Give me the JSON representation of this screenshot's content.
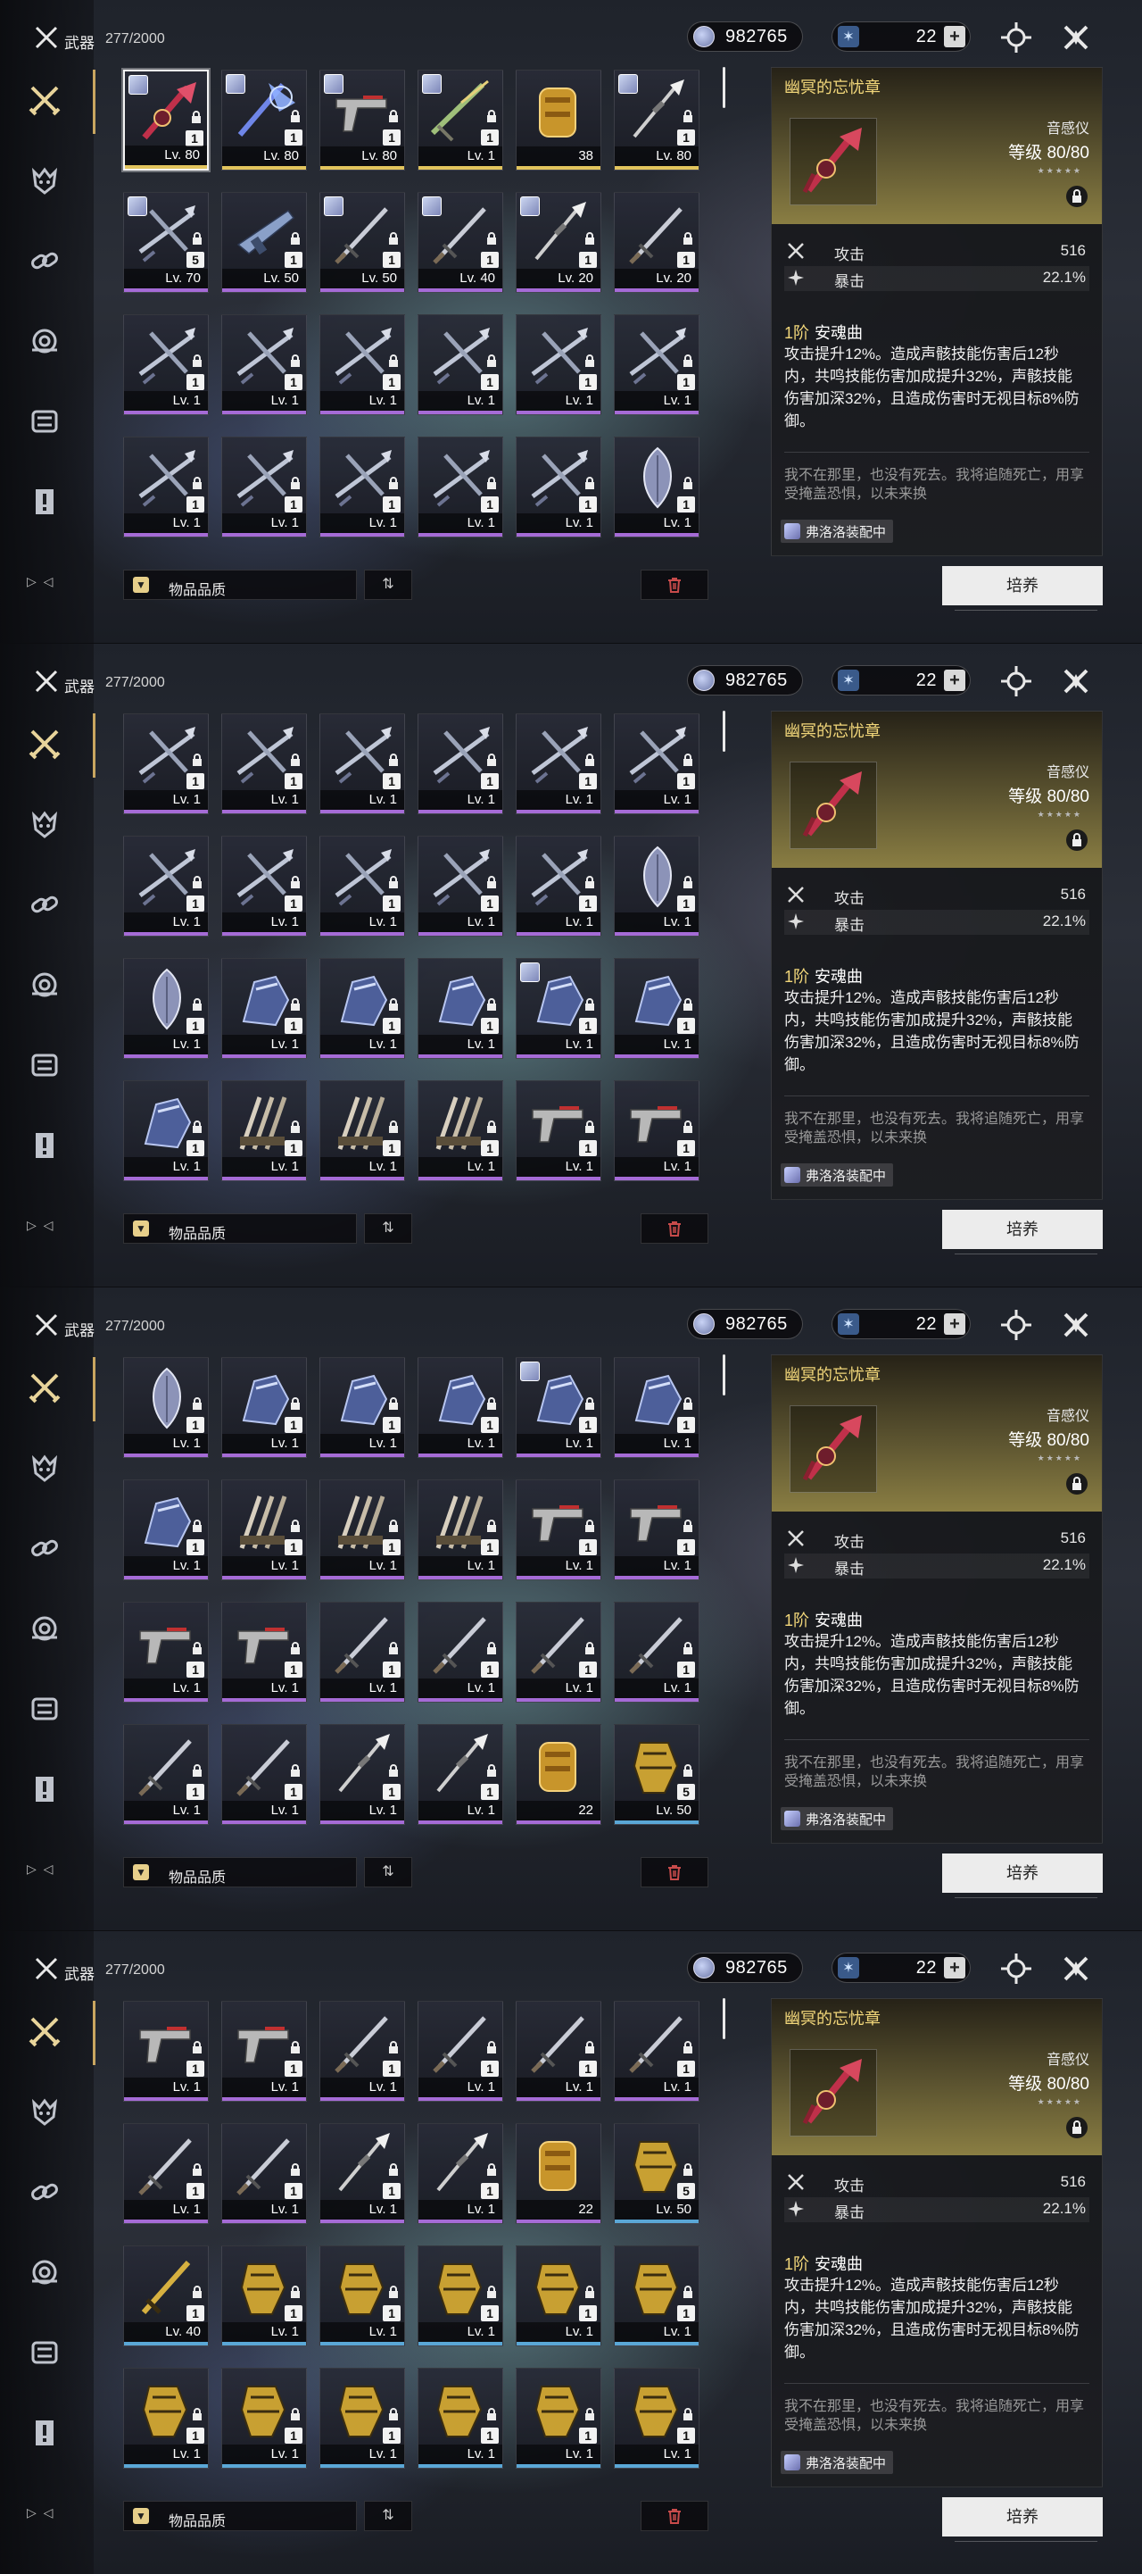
{
  "header": {
    "title": "武器",
    "count": "277/2000"
  },
  "currency": {
    "value": "982765"
  },
  "stamina": {
    "value": "22",
    "plus": "+"
  },
  "sort": {
    "label": "物品品质",
    "order_glyph": "⇅"
  },
  "nav_arrows": "▷ ◁",
  "detail": {
    "name": "幽冥的忘忧章",
    "type": "音感仪",
    "level": "等级 80/80",
    "stars": "★★★★★",
    "stats": [
      {
        "name": "攻击",
        "value": "516"
      },
      {
        "name": "暴击",
        "value": "22.1%"
      }
    ],
    "skill_rank": "1阶",
    "skill_name": "安魂曲",
    "skill_desc": "攻击提升12%。造成声骸技能伤害后12秒内，共鸣技能伤害加成提升32%，声骸技能伤害加深32%，且造成伤害时无视目标8%防御。",
    "flavor": "我不在那里，也没有死去。我将追随死亡，用享受掩盖恐惧，以未来换",
    "equipped_label": "弗洛洛装配中",
    "develop_label": "培养"
  },
  "colors": {
    "accent_gold": "#c9a660",
    "purple": "#a56bd6",
    "blue": "#5aa7d6",
    "gold": "#e2c45d"
  },
  "panels": [
    {
      "cells": [
        {
          "w": "crimson",
          "qty": "1",
          "level": "Lv. 80",
          "q": "gold",
          "sel": true,
          "av": true
        },
        {
          "w": "blueblade",
          "qty": "1",
          "level": "Lv. 80",
          "q": "gold",
          "av": true
        },
        {
          "w": "pistol",
          "qty": "1",
          "level": "Lv. 80",
          "q": "gold",
          "av": true
        },
        {
          "w": "greenblade",
          "qty": "1",
          "level": "Lv. 1",
          "q": "gold",
          "av": true
        },
        {
          "w": "tube",
          "qty": "",
          "level": "38",
          "q": "gold"
        },
        {
          "w": "spear",
          "qty": "1",
          "level": "Lv. 80",
          "q": "gold",
          "av": true
        },
        {
          "w": "cross",
          "qty": "5",
          "level": "Lv. 70",
          "q": "purple",
          "av": true
        },
        {
          "w": "gun",
          "qty": "1",
          "level": "Lv. 50",
          "q": "purple"
        },
        {
          "w": "sword",
          "qty": "1",
          "level": "Lv. 50",
          "q": "purple",
          "av": true
        },
        {
          "w": "sword",
          "qty": "1",
          "level": "Lv. 40",
          "q": "purple",
          "av": true
        },
        {
          "w": "spear",
          "qty": "1",
          "level": "Lv. 20",
          "q": "purple",
          "av": true
        },
        {
          "w": "sword",
          "qty": "1",
          "level": "Lv. 20",
          "q": "purple"
        },
        {
          "w": "cross",
          "qty": "1",
          "level": "Lv. 1",
          "q": "purple"
        },
        {
          "w": "cross",
          "qty": "1",
          "level": "Lv. 1",
          "q": "purple"
        },
        {
          "w": "cross",
          "qty": "1",
          "level": "Lv. 1",
          "q": "purple"
        },
        {
          "w": "cross",
          "qty": "1",
          "level": "Lv. 1",
          "q": "purple"
        },
        {
          "w": "cross",
          "qty": "1",
          "level": "Lv. 1",
          "q": "purple"
        },
        {
          "w": "cross",
          "qty": "1",
          "level": "Lv. 1",
          "q": "purple"
        },
        {
          "w": "cross",
          "qty": "1",
          "level": "Lv. 1",
          "q": "purple"
        },
        {
          "w": "cross",
          "qty": "1",
          "level": "Lv. 1",
          "q": "purple"
        },
        {
          "w": "cross",
          "qty": "1",
          "level": "Lv. 1",
          "q": "purple"
        },
        {
          "w": "cross",
          "qty": "1",
          "level": "Lv. 1",
          "q": "purple"
        },
        {
          "w": "cross",
          "qty": "1",
          "level": "Lv. 1",
          "q": "purple"
        },
        {
          "w": "leaf",
          "qty": "1",
          "level": "Lv. 1",
          "q": "purple"
        }
      ]
    },
    {
      "cells": [
        {
          "w": "cross",
          "qty": "1",
          "level": "Lv. 1",
          "q": "purple"
        },
        {
          "w": "cross",
          "qty": "1",
          "level": "Lv. 1",
          "q": "purple"
        },
        {
          "w": "cross",
          "qty": "1",
          "level": "Lv. 1",
          "q": "purple"
        },
        {
          "w": "cross",
          "qty": "1",
          "level": "Lv. 1",
          "q": "purple"
        },
        {
          "w": "cross",
          "qty": "1",
          "level": "Lv. 1",
          "q": "purple"
        },
        {
          "w": "cross",
          "qty": "1",
          "level": "Lv. 1",
          "q": "purple"
        },
        {
          "w": "cross",
          "qty": "1",
          "level": "Lv. 1",
          "q": "purple"
        },
        {
          "w": "cross",
          "qty": "1",
          "level": "Lv. 1",
          "q": "purple"
        },
        {
          "w": "cross",
          "qty": "1",
          "level": "Lv. 1",
          "q": "purple"
        },
        {
          "w": "cross",
          "qty": "1",
          "level": "Lv. 1",
          "q": "purple"
        },
        {
          "w": "cross",
          "qty": "1",
          "level": "Lv. 1",
          "q": "purple"
        },
        {
          "w": "leaf",
          "qty": "1",
          "level": "Lv. 1",
          "q": "purple"
        },
        {
          "w": "leaf",
          "qty": "1",
          "level": "Lv. 1",
          "q": "purple"
        },
        {
          "w": "gauntlet",
          "qty": "1",
          "level": "Lv. 1",
          "q": "purple"
        },
        {
          "w": "gauntlet",
          "qty": "1",
          "level": "Lv. 1",
          "q": "purple"
        },
        {
          "w": "gauntlet",
          "qty": "1",
          "level": "Lv. 1",
          "q": "purple"
        },
        {
          "w": "gauntlet",
          "qty": "1",
          "level": "Lv. 1",
          "q": "purple",
          "av": true
        },
        {
          "w": "gauntlet",
          "qty": "1",
          "level": "Lv. 1",
          "q": "purple"
        },
        {
          "w": "gauntlet",
          "qty": "1",
          "level": "Lv. 1",
          "q": "purple"
        },
        {
          "w": "claws",
          "qty": "1",
          "level": "Lv. 1",
          "q": "purple"
        },
        {
          "w": "claws",
          "qty": "1",
          "level": "Lv. 1",
          "q": "purple"
        },
        {
          "w": "claws",
          "qty": "1",
          "level": "Lv. 1",
          "q": "purple"
        },
        {
          "w": "pistol",
          "qty": "1",
          "level": "Lv. 1",
          "q": "purple"
        },
        {
          "w": "pistol",
          "qty": "1",
          "level": "Lv. 1",
          "q": "purple"
        }
      ]
    },
    {
      "cells": [
        {
          "w": "leaf",
          "qty": "1",
          "level": "Lv. 1",
          "q": "purple"
        },
        {
          "w": "gauntlet",
          "qty": "1",
          "level": "Lv. 1",
          "q": "purple"
        },
        {
          "w": "gauntlet",
          "qty": "1",
          "level": "Lv. 1",
          "q": "purple"
        },
        {
          "w": "gauntlet",
          "qty": "1",
          "level": "Lv. 1",
          "q": "purple"
        },
        {
          "w": "gauntlet",
          "qty": "1",
          "level": "Lv. 1",
          "q": "purple",
          "av": true
        },
        {
          "w": "gauntlet",
          "qty": "1",
          "level": "Lv. 1",
          "q": "purple"
        },
        {
          "w": "gauntlet",
          "qty": "1",
          "level": "Lv. 1",
          "q": "purple"
        },
        {
          "w": "claws",
          "qty": "1",
          "level": "Lv. 1",
          "q": "purple"
        },
        {
          "w": "claws",
          "qty": "1",
          "level": "Lv. 1",
          "q": "purple"
        },
        {
          "w": "claws",
          "qty": "1",
          "level": "Lv. 1",
          "q": "purple"
        },
        {
          "w": "pistol",
          "qty": "1",
          "level": "Lv. 1",
          "q": "purple"
        },
        {
          "w": "pistol",
          "qty": "1",
          "level": "Lv. 1",
          "q": "purple"
        },
        {
          "w": "pistol",
          "qty": "1",
          "level": "Lv. 1",
          "q": "purple"
        },
        {
          "w": "pistol",
          "qty": "1",
          "level": "Lv. 1",
          "q": "purple"
        },
        {
          "w": "sword",
          "qty": "1",
          "level": "Lv. 1",
          "q": "purple"
        },
        {
          "w": "sword",
          "qty": "1",
          "level": "Lv. 1",
          "q": "purple"
        },
        {
          "w": "sword",
          "qty": "1",
          "level": "Lv. 1",
          "q": "purple"
        },
        {
          "w": "sword",
          "qty": "1",
          "level": "Lv. 1",
          "q": "purple"
        },
        {
          "w": "sword",
          "qty": "1",
          "level": "Lv. 1",
          "q": "purple"
        },
        {
          "w": "sword",
          "qty": "1",
          "level": "Lv. 1",
          "q": "purple"
        },
        {
          "w": "spear",
          "qty": "1",
          "level": "Lv. 1",
          "q": "purple"
        },
        {
          "w": "spear",
          "qty": "1",
          "level": "Lv. 1",
          "q": "purple"
        },
        {
          "w": "tube",
          "qty": "",
          "level": "22",
          "q": "purple"
        },
        {
          "w": "goldarm",
          "qty": "5",
          "level": "Lv. 50",
          "q": "blue"
        }
      ]
    },
    {
      "cells": [
        {
          "w": "pistol",
          "qty": "1",
          "level": "Lv. 1",
          "q": "purple"
        },
        {
          "w": "pistol",
          "qty": "1",
          "level": "Lv. 1",
          "q": "purple"
        },
        {
          "w": "sword",
          "qty": "1",
          "level": "Lv. 1",
          "q": "purple"
        },
        {
          "w": "sword",
          "qty": "1",
          "level": "Lv. 1",
          "q": "purple"
        },
        {
          "w": "sword",
          "qty": "1",
          "level": "Lv. 1",
          "q": "purple"
        },
        {
          "w": "sword",
          "qty": "1",
          "level": "Lv. 1",
          "q": "purple"
        },
        {
          "w": "sword",
          "qty": "1",
          "level": "Lv. 1",
          "q": "purple"
        },
        {
          "w": "sword",
          "qty": "1",
          "level": "Lv. 1",
          "q": "purple"
        },
        {
          "w": "spear",
          "qty": "1",
          "level": "Lv. 1",
          "q": "purple"
        },
        {
          "w": "spear",
          "qty": "1",
          "level": "Lv. 1",
          "q": "purple"
        },
        {
          "w": "tube",
          "qty": "",
          "level": "22",
          "q": "purple"
        },
        {
          "w": "goldarm",
          "qty": "5",
          "level": "Lv. 50",
          "q": "blue"
        },
        {
          "w": "goldsword",
          "qty": "1",
          "level": "Lv. 40",
          "q": "blue"
        },
        {
          "w": "goldarm",
          "qty": "1",
          "level": "Lv. 1",
          "q": "blue"
        },
        {
          "w": "goldarm",
          "qty": "1",
          "level": "Lv. 1",
          "q": "blue"
        },
        {
          "w": "goldarm",
          "qty": "1",
          "level": "Lv. 1",
          "q": "blue"
        },
        {
          "w": "goldarm",
          "qty": "1",
          "level": "Lv. 1",
          "q": "blue"
        },
        {
          "w": "goldarm",
          "qty": "1",
          "level": "Lv. 1",
          "q": "blue"
        },
        {
          "w": "goldarm",
          "qty": "1",
          "level": "Lv. 1",
          "q": "blue"
        },
        {
          "w": "goldarm",
          "qty": "1",
          "level": "Lv. 1",
          "q": "blue"
        },
        {
          "w": "goldarm",
          "qty": "1",
          "level": "Lv. 1",
          "q": "blue"
        },
        {
          "w": "goldarm",
          "qty": "1",
          "level": "Lv. 1",
          "q": "blue"
        },
        {
          "w": "goldarm",
          "qty": "1",
          "level": "Lv. 1",
          "q": "blue"
        },
        {
          "w": "goldarm",
          "qty": "1",
          "level": "Lv. 1",
          "q": "blue"
        }
      ]
    }
  ]
}
